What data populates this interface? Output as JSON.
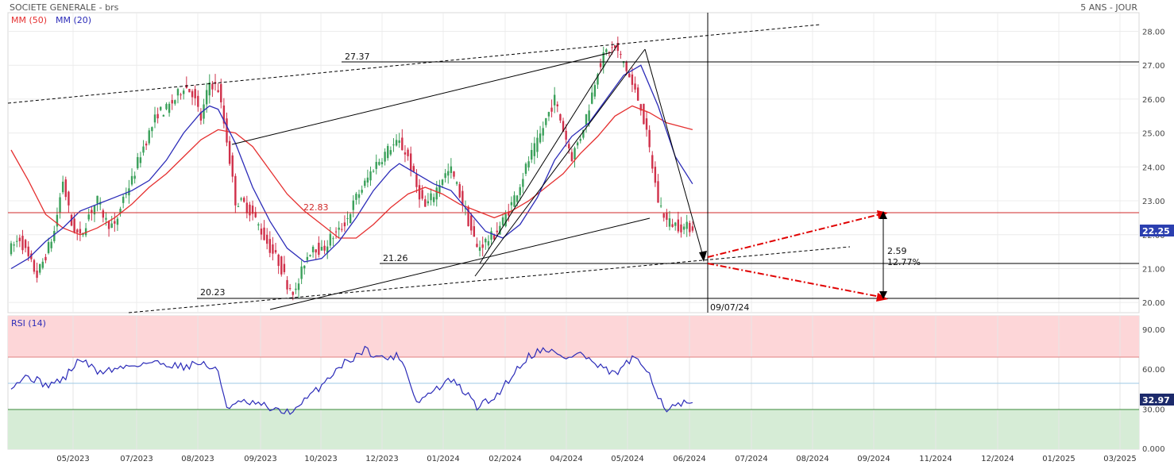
{
  "header": {
    "title": "SOCIETE GENERALE - brs",
    "period": "5 ANS - JOUR"
  },
  "colors": {
    "ma50": "#e53030",
    "ma20": "#2b2bb8",
    "up": "#3aa05a",
    "down": "#d0304a",
    "rsi": "#2b2bb8",
    "last_price_bg": "#2b3fb0",
    "rsi_last_bg": "#1c2a6b",
    "overbought_zone": "#fdd6d8",
    "oversold_zone": "#d6ecd6",
    "level_22_83": "#d02a2a"
  },
  "chart_data": [
    {
      "type": "candlestick",
      "title": "SOCIETE GENERALE - brs",
      "series": [
        {
          "name": "MM (50)"
        },
        {
          "name": "MM (20)"
        }
      ],
      "x_ticks": [
        "05/2023",
        "07/2023",
        "08/2023",
        "09/2023",
        "10/2023",
        "12/2023",
        "01/2024",
        "02/2024",
        "04/2024",
        "05/2024",
        "06/2024",
        "07/2024",
        "08/2024",
        "09/2024",
        "11/2024",
        "12/2024",
        "01/2025",
        "03/2025"
      ],
      "y_ticks": [
        "28.00",
        "27.00",
        "26.00",
        "25.00",
        "24.00",
        "23.00",
        "22.00",
        "21.00",
        "20.00"
      ],
      "ylim": [
        19.7,
        28.55
      ],
      "grid": true,
      "last_price": "22.25",
      "levels": {
        "resistance": "27.37",
        "mid": "22.83",
        "support": "21.26",
        "low": "20.23"
      },
      "annotations": {
        "range_abs": "2.59",
        "range_pct": "12.77%",
        "date_marker": "09/07/24"
      },
      "price_path": [
        [
          0,
          21.6
        ],
        [
          3,
          21.9
        ],
        [
          6,
          21.3
        ],
        [
          9,
          20.8
        ],
        [
          12,
          21.4
        ],
        [
          15,
          22.1
        ],
        [
          18,
          23.6
        ],
        [
          21,
          22.3
        ],
        [
          24,
          21.9
        ],
        [
          27,
          22.6
        ],
        [
          30,
          23.0
        ],
        [
          33,
          22.4
        ],
        [
          36,
          22.2
        ],
        [
          39,
          23.1
        ],
        [
          42,
          23.6
        ],
        [
          45,
          24.4
        ],
        [
          48,
          25.0
        ],
        [
          51,
          25.6
        ],
        [
          54,
          25.7
        ],
        [
          57,
          26.0
        ],
        [
          60,
          26.4
        ],
        [
          63,
          26.2
        ],
        [
          66,
          25.4
        ],
        [
          69,
          26.5
        ],
        [
          72,
          26.3
        ],
        [
          75,
          24.8
        ],
        [
          78,
          23.0
        ],
        [
          81,
          22.9
        ],
        [
          84,
          22.6
        ],
        [
          87,
          22.1
        ],
        [
          90,
          21.6
        ],
        [
          93,
          21.2
        ],
        [
          96,
          20.55
        ],
        [
          99,
          20.3
        ],
        [
          102,
          21.2
        ],
        [
          105,
          21.7
        ],
        [
          108,
          21.5
        ],
        [
          111,
          21.9
        ],
        [
          114,
          22.1
        ],
        [
          117,
          22.5
        ],
        [
          120,
          23.1
        ],
        [
          123,
          23.5
        ],
        [
          126,
          24.0
        ],
        [
          129,
          24.3
        ],
        [
          132,
          24.6
        ],
        [
          135,
          24.7
        ],
        [
          138,
          24.3
        ],
        [
          141,
          23.4
        ],
        [
          144,
          22.8
        ],
        [
          147,
          23.2
        ],
        [
          150,
          23.7
        ],
        [
          153,
          23.9
        ],
        [
          156,
          23.2
        ],
        [
          159,
          22.4
        ],
        [
          162,
          21.6
        ],
        [
          165,
          21.8
        ],
        [
          168,
          22.0
        ],
        [
          171,
          22.4
        ],
        [
          174,
          22.9
        ],
        [
          177,
          23.5
        ],
        [
          180,
          24.2
        ],
        [
          183,
          24.7
        ],
        [
          186,
          25.4
        ],
        [
          189,
          26.0
        ],
        [
          192,
          25.1
        ],
        [
          195,
          24.3
        ],
        [
          198,
          24.9
        ],
        [
          201,
          25.8
        ],
        [
          204,
          26.9
        ],
        [
          207,
          27.4
        ],
        [
          210,
          27.5
        ],
        [
          213,
          27.1
        ],
        [
          216,
          26.4
        ],
        [
          219,
          25.8
        ],
        [
          222,
          24.5
        ],
        [
          225,
          23.0
        ],
        [
          228,
          22.4
        ],
        [
          231,
          22.3
        ],
        [
          234,
          22.2
        ],
        [
          237,
          22.25
        ]
      ],
      "ma20_path": [
        [
          0,
          21.0
        ],
        [
          6,
          21.3
        ],
        [
          12,
          21.8
        ],
        [
          18,
          22.2
        ],
        [
          24,
          22.7
        ],
        [
          30,
          22.9
        ],
        [
          36,
          23.1
        ],
        [
          42,
          23.3
        ],
        [
          48,
          23.6
        ],
        [
          54,
          24.2
        ],
        [
          60,
          25.0
        ],
        [
          66,
          25.6
        ],
        [
          69,
          25.8
        ],
        [
          72,
          25.7
        ],
        [
          78,
          24.7
        ],
        [
          84,
          23.4
        ],
        [
          90,
          22.4
        ],
        [
          96,
          21.6
        ],
        [
          102,
          21.2
        ],
        [
          108,
          21.3
        ],
        [
          114,
          21.8
        ],
        [
          120,
          22.5
        ],
        [
          126,
          23.3
        ],
        [
          132,
          23.9
        ],
        [
          135,
          24.1
        ],
        [
          141,
          23.8
        ],
        [
          147,
          23.5
        ],
        [
          153,
          23.3
        ],
        [
          159,
          22.7
        ],
        [
          165,
          22.1
        ],
        [
          171,
          21.9
        ],
        [
          177,
          22.3
        ],
        [
          183,
          23.1
        ],
        [
          189,
          24.2
        ],
        [
          195,
          24.9
        ],
        [
          201,
          25.3
        ],
        [
          207,
          26.0
        ],
        [
          213,
          26.7
        ],
        [
          219,
          27.0
        ],
        [
          225,
          25.8
        ],
        [
          231,
          24.3
        ],
        [
          237,
          23.5
        ]
      ],
      "ma50_path": [
        [
          0,
          24.5
        ],
        [
          6,
          23.6
        ],
        [
          12,
          22.6
        ],
        [
          18,
          22.2
        ],
        [
          24,
          22.0
        ],
        [
          30,
          22.2
        ],
        [
          36,
          22.5
        ],
        [
          42,
          22.9
        ],
        [
          48,
          23.4
        ],
        [
          54,
          23.8
        ],
        [
          60,
          24.3
        ],
        [
          66,
          24.8
        ],
        [
          72,
          25.1
        ],
        [
          78,
          25.0
        ],
        [
          84,
          24.6
        ],
        [
          90,
          23.9
        ],
        [
          96,
          23.2
        ],
        [
          102,
          22.7
        ],
        [
          108,
          22.3
        ],
        [
          114,
          21.9
        ],
        [
          120,
          21.9
        ],
        [
          126,
          22.3
        ],
        [
          132,
          22.8
        ],
        [
          138,
          23.2
        ],
        [
          144,
          23.4
        ],
        [
          150,
          23.2
        ],
        [
          156,
          22.9
        ],
        [
          162,
          22.7
        ],
        [
          168,
          22.5
        ],
        [
          174,
          22.7
        ],
        [
          180,
          23.0
        ],
        [
          186,
          23.4
        ],
        [
          192,
          23.8
        ],
        [
          198,
          24.4
        ],
        [
          204,
          24.9
        ],
        [
          210,
          25.5
        ],
        [
          216,
          25.8
        ],
        [
          222,
          25.6
        ],
        [
          228,
          25.3
        ],
        [
          237,
          25.1
        ]
      ]
    },
    {
      "type": "line",
      "title": "RSI (14)",
      "series": [
        {
          "name": "RSI (14)"
        }
      ],
      "y_ticks": [
        "90.00",
        "60.00",
        "30.00",
        "0.000"
      ],
      "ylim": [
        0,
        100
      ],
      "overbought": 70,
      "oversold": 30,
      "last_value": "32.97",
      "path": [
        [
          0,
          48
        ],
        [
          6,
          55
        ],
        [
          12,
          48
        ],
        [
          18,
          52
        ],
        [
          24,
          68
        ],
        [
          30,
          58
        ],
        [
          36,
          60
        ],
        [
          42,
          63
        ],
        [
          48,
          65
        ],
        [
          54,
          64
        ],
        [
          60,
          62
        ],
        [
          66,
          65
        ],
        [
          72,
          58
        ],
        [
          75,
          32
        ],
        [
          81,
          35
        ],
        [
          87,
          33
        ],
        [
          93,
          28
        ],
        [
          99,
          29
        ],
        [
          102,
          36
        ],
        [
          108,
          48
        ],
        [
          114,
          62
        ],
        [
          120,
          70
        ],
        [
          123,
          75
        ],
        [
          129,
          68
        ],
        [
          135,
          70
        ],
        [
          138,
          56
        ],
        [
          141,
          35
        ],
        [
          147,
          44
        ],
        [
          153,
          52
        ],
        [
          159,
          40
        ],
        [
          162,
          32
        ],
        [
          168,
          38
        ],
        [
          174,
          55
        ],
        [
          180,
          70
        ],
        [
          186,
          76
        ],
        [
          192,
          68
        ],
        [
          198,
          72
        ],
        [
          204,
          62
        ],
        [
          210,
          56
        ],
        [
          216,
          68
        ],
        [
          222,
          58
        ],
        [
          225,
          40
        ],
        [
          228,
          30
        ],
        [
          234,
          34
        ],
        [
          237,
          33
        ]
      ]
    }
  ]
}
